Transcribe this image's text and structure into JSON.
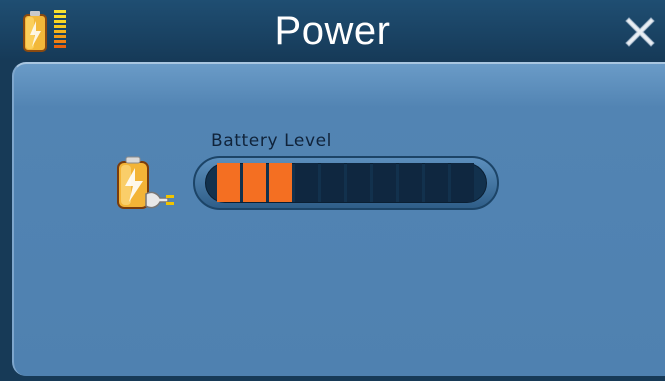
{
  "window": {
    "title": "Power",
    "app_icon": "battery-status-icon",
    "close_icon": "close-icon"
  },
  "battery": {
    "label": "Battery Level",
    "icon": "battery-charging-icon",
    "segments_total": 10,
    "segments_filled": 3,
    "level": 0.3,
    "fill_color": "#f46f22",
    "empty_color": "#0f2740"
  },
  "colors": {
    "titlebar": "#1a4364",
    "panel": "#4f81b0",
    "title_text": "#ffffff"
  }
}
